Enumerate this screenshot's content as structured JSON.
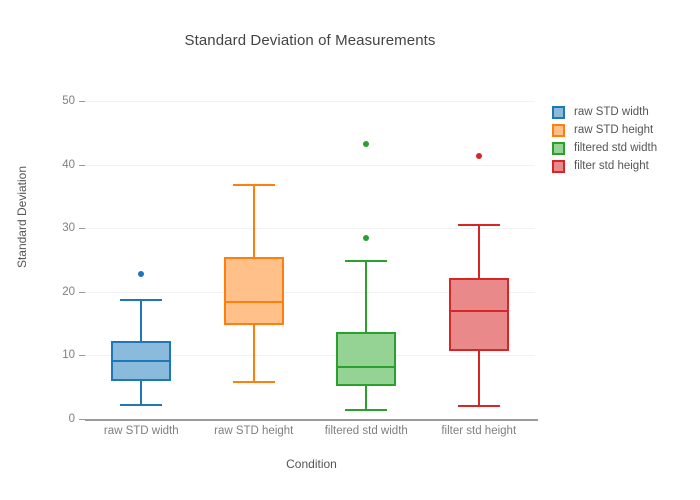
{
  "chart_data": {
    "type": "box",
    "title": "Standard Deviation of Measurements",
    "xlabel": "Condition",
    "ylabel": "Standard Deviation",
    "ylim": [
      0,
      50
    ],
    "yticks": [
      0,
      10,
      20,
      30,
      40,
      50
    ],
    "grid": true,
    "legend_position": "right",
    "categories": [
      "raw STD width",
      "raw STD height",
      "filtered std width",
      "filter std height"
    ],
    "series": [
      {
        "name": "raw STD width",
        "color": "#1f77b4",
        "fill": "#8bbbdc",
        "whisker_low": 2.4,
        "q1": 6.0,
        "median": 9.1,
        "q3": 12.3,
        "whisker_high": 18.9,
        "outliers": [
          22.8
        ]
      },
      {
        "name": "raw STD height",
        "color": "#ff7f0e",
        "fill": "#ffc08a",
        "whisker_low": 6.0,
        "q1": 14.8,
        "median": 18.4,
        "q3": 25.4,
        "whisker_high": 36.9,
        "outliers": []
      },
      {
        "name": "filtered std width",
        "color": "#2ca02c",
        "fill": "#94d394",
        "whisker_low": 1.5,
        "q1": 5.2,
        "median": 8.2,
        "q3": 13.7,
        "whisker_high": 25.0,
        "outliers": [
          43.3,
          28.4
        ]
      },
      {
        "name": "filter std height",
        "color": "#d62728",
        "fill": "#e9898a",
        "whisker_low": 2.2,
        "q1": 10.7,
        "median": 17.0,
        "q3": 22.2,
        "whisker_high": 30.6,
        "outliers": [
          41.3
        ]
      }
    ]
  },
  "legend": {
    "items": [
      {
        "label": "raw STD width"
      },
      {
        "label": "raw STD height"
      },
      {
        "label": "filtered std width"
      },
      {
        "label": "filter std height"
      }
    ]
  }
}
